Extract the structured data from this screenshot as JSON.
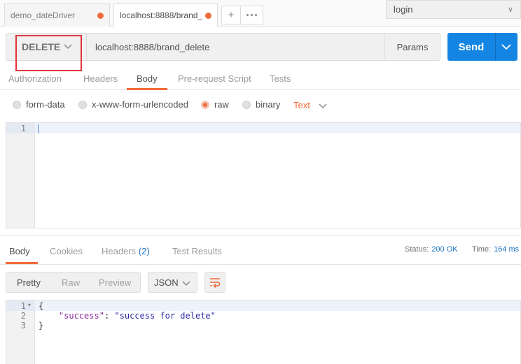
{
  "tabs": [
    {
      "label": "demo_dateDriver",
      "unsaved": true
    },
    {
      "label": "localhost:8888/brand_",
      "unsaved": true
    }
  ],
  "environment": {
    "selected": "login"
  },
  "request": {
    "method": "DELETE",
    "url": "localhost:8888/brand_delete",
    "params_label": "Params",
    "send_label": "Send"
  },
  "request_tabs": {
    "authorization": "Authorization",
    "headers": "Headers",
    "body": "Body",
    "prerequest": "Pre-request Script",
    "tests": "Tests",
    "active": "Body"
  },
  "body_types": {
    "form_data": "form-data",
    "urlencoded": "x-www-form-urlencoded",
    "raw": "raw",
    "binary": "binary",
    "selected": "raw",
    "content_type": "Text"
  },
  "request_editor": {
    "line_numbers": [
      "1"
    ]
  },
  "response": {
    "tabs": {
      "body": "Body",
      "cookies": "Cookies",
      "headers": "Headers",
      "headers_count": "(2)",
      "test_results": "Test Results"
    },
    "status_label": "Status:",
    "status_value": "200 OK",
    "time_label": "Time:",
    "time_value": "164 ms",
    "view_modes": {
      "pretty": "Pretty",
      "raw": "Raw",
      "preview": "Preview"
    },
    "format": "JSON",
    "line_numbers": [
      "1",
      "2",
      "3"
    ],
    "code": {
      "open": "{",
      "key": "\"success\"",
      "colon": ": ",
      "value": "\"success for delete\"",
      "close": "}"
    }
  },
  "colors": {
    "accent": "#f26b3a",
    "send": "#1585e3",
    "highlight": "#e0343a",
    "link": "#1a74c5"
  }
}
